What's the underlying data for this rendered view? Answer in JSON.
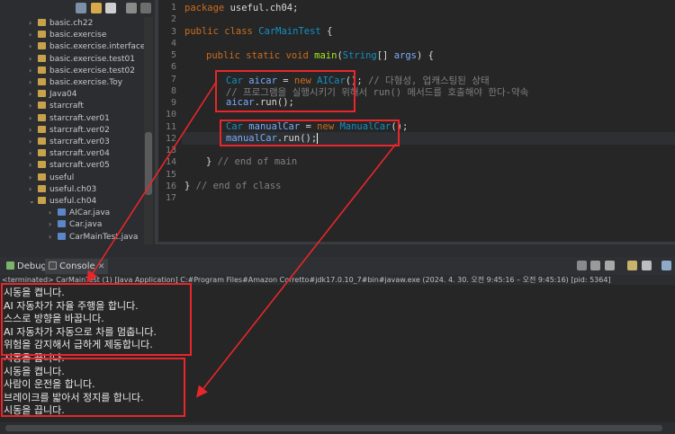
{
  "package_explorer": {
    "items": [
      {
        "label": "basic.ch22",
        "type": "package"
      },
      {
        "label": "basic.exercise",
        "type": "package"
      },
      {
        "label": "basic.exercise.interfaces",
        "type": "package"
      },
      {
        "label": "basic.exercise.test01",
        "type": "package"
      },
      {
        "label": "basic.exercise.test02",
        "type": "package"
      },
      {
        "label": "basic.exercise.Toy",
        "type": "package"
      },
      {
        "label": "Java04",
        "type": "package"
      },
      {
        "label": "starcraft",
        "type": "package"
      },
      {
        "label": "starcraft.ver01",
        "type": "package"
      },
      {
        "label": "starcraft.ver02",
        "type": "package"
      },
      {
        "label": "starcraft.ver03",
        "type": "package"
      },
      {
        "label": "starcraft.ver04",
        "type": "package"
      },
      {
        "label": "starcraft.ver05",
        "type": "package"
      },
      {
        "label": "useful",
        "type": "package"
      },
      {
        "label": "useful.ch03",
        "type": "package"
      },
      {
        "label": "useful.ch04",
        "type": "package",
        "expanded": true
      },
      {
        "label": "AICar.java",
        "type": "file"
      },
      {
        "label": "Car.java",
        "type": "file"
      },
      {
        "label": "CarMainTest.java",
        "type": "file"
      }
    ]
  },
  "editor": {
    "line_numbers": [
      "1",
      "2",
      "3",
      "4",
      "5",
      "6",
      "7",
      "8",
      "9",
      "10",
      "11",
      "12",
      "13",
      "14",
      "15",
      "16",
      "17"
    ],
    "code": {
      "l1_kw": "package",
      "l1_rest": " useful.ch04;",
      "l3_kw1": "public",
      "l3_kw2": "class",
      "l3_cls": "CarMainTest",
      "l3_rest": " {",
      "l5_kw1": "public",
      "l5_kw2": "static",
      "l5_kw3": "void",
      "l5_fn": "main",
      "l5_p1": "(",
      "l5_cls": "String",
      "l5_p2": "[] ",
      "l5_arg": "args",
      "l5_p3": ") {",
      "l7_cls": "Car",
      "l7_var": "aicar",
      "l7_eq": " = ",
      "l7_kw": "new",
      "l7_cls2": "AICar",
      "l7_end": "();",
      "l7_cm": " // 다형성, 업캐스팅된 상태",
      "l8_cm": "// 프로그램을 실행시키기 위해서 run() 메서드를 호출해야 한다-약속",
      "l9_var": "aicar",
      "l9_dot": ".",
      "l9_fn": "run",
      "l9_end": "();",
      "l11_cls": "Car",
      "l11_var": "manualCar",
      "l11_eq": " = ",
      "l11_kw": "new",
      "l11_cls2": "ManualCar",
      "l11_end": "();",
      "l12_var": "manualCar",
      "l12_dot": ".",
      "l12_fn": "run",
      "l12_end": "();",
      "l14_brace": "}",
      "l14_cm": " // end of main",
      "l16_brace": "}",
      "l16_cm": " // end of class"
    }
  },
  "panel_tabs": {
    "debug": "Debug",
    "console": "Console"
  },
  "console": {
    "status": "<terminated> CarMainTest (1) [Java Application] C:#Program Files#Amazon Corretto#jdk17.0.10_7#bin#javaw.exe  (2024. 4. 30. 오전 9:45:16 – 오전 9:45:16) [pid: 5364]",
    "lines": [
      "시동을 켭니다.",
      "AI 자동차가 자율 주행을 합니다.",
      "스스로 방향을 바꿉니다.",
      "AI 자동차가 자동으로 차를 멈춥니다.",
      "위험을 감지해서 급하게 제동합니다.",
      "시동을 끕니다.",
      "시동을 켭니다.",
      "사람이 운전을 합니다.",
      "브레이크를 밟아서 정지를 합니다.",
      "시동을 끕니다."
    ]
  },
  "colors": {
    "annotation_red": "#e8262b",
    "keyword": "#cc6c1d",
    "class": "#1290c3",
    "field": "#f2f200",
    "method": "#a7ec21"
  }
}
